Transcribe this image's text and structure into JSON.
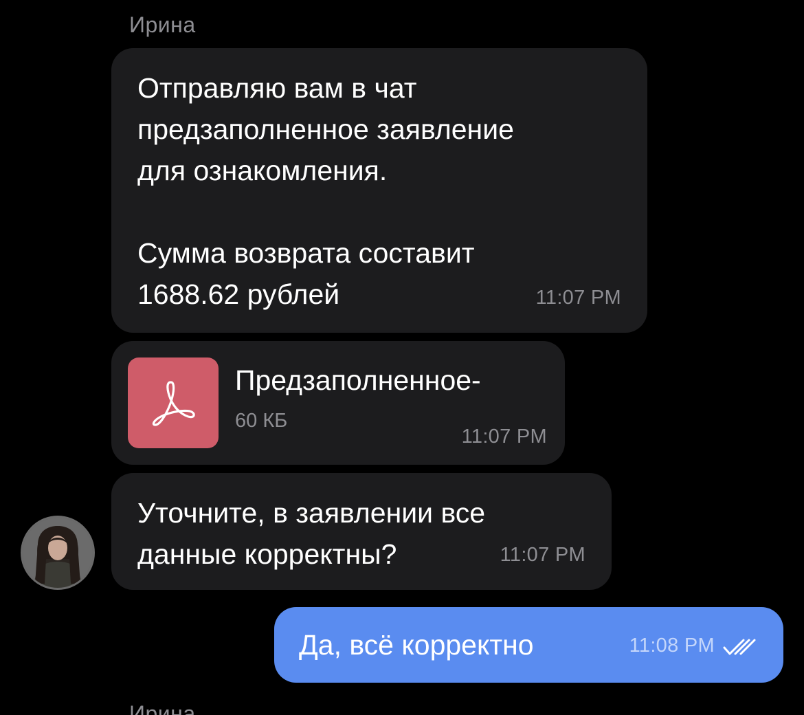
{
  "chat": {
    "sender_name": "Ирина",
    "next_sender_name": "Ирина",
    "messages": [
      {
        "text": "Отправляю вам в чат\nпредзаполненное заявление\nдля ознакомления.\n\nСумма возврата составит\n1688.62 рублей",
        "time": "11:07 PM"
      },
      {
        "file_name": "Предзаполненное-",
        "file_size": "60 КБ",
        "file_icon": "pdf-icon",
        "time": "11:07 PM"
      },
      {
        "text": "Уточните, в заявлении все\nданные корректны?",
        "time": "11:07 PM"
      }
    ],
    "outgoing": {
      "text": "Да, всё корректно",
      "time": "11:08 PM",
      "status_icon": "double-check-icon"
    }
  },
  "colors": {
    "background": "#000000",
    "incoming_bubble": "#1c1c1e",
    "outgoing_bubble": "#5a8cf0",
    "pdf_icon_bg": "#cf5c69",
    "secondary_text": "#8e8e93"
  }
}
